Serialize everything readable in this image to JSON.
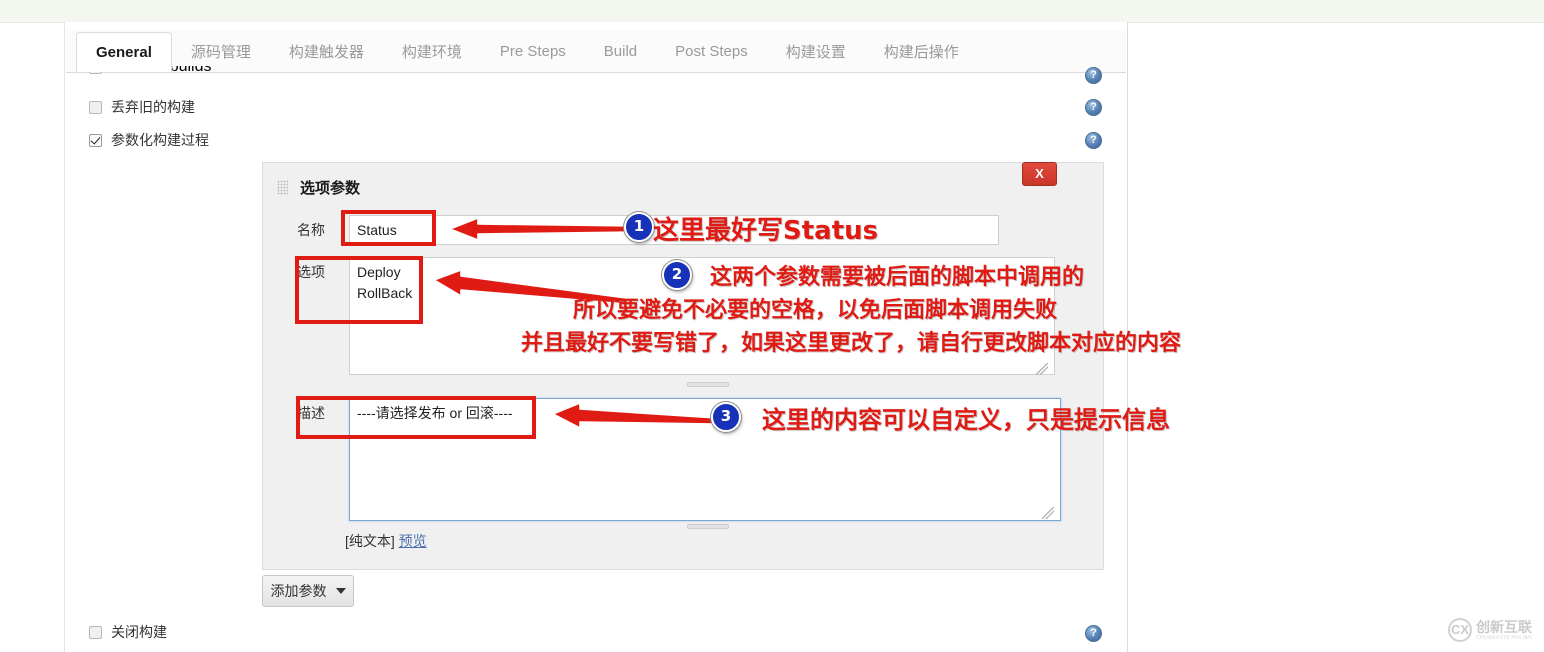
{
  "window": {
    "tabs": [
      {
        "label": "General",
        "active": true
      },
      {
        "label": "源码管理",
        "active": false
      },
      {
        "label": "构建触发器",
        "active": false
      },
      {
        "label": "构建环境",
        "active": false
      },
      {
        "label": "Pre Steps",
        "active": false
      },
      {
        "label": "Build",
        "active": false
      },
      {
        "label": "Post Steps",
        "active": false
      },
      {
        "label": "构建设置",
        "active": false
      },
      {
        "label": "构建后操作",
        "active": false
      }
    ]
  },
  "checkboxes": [
    {
      "label": "Throttle builds",
      "checked": false
    },
    {
      "label": "丢弃旧的构建",
      "checked": false
    },
    {
      "label": "参数化构建过程",
      "checked": true
    },
    {
      "label": "关闭构建",
      "checked": false
    }
  ],
  "panel": {
    "title": "选项参数",
    "close_label": "X",
    "fields": {
      "name_label": "名称",
      "name_value": "Status",
      "options_label": "选项",
      "options_value": "Deploy\nRollBack",
      "description_label": "描述",
      "description_value": "----请选择发布 or 回滚----"
    },
    "markup_prefix": "[纯文本]",
    "preview_link": "预览",
    "add_param_label": "添加参数"
  },
  "help_icon": "?",
  "annotations": [
    {
      "number": "1",
      "lines": [
        "这里最好写Status"
      ],
      "highlight": "Status"
    },
    {
      "number": "2",
      "lines": [
        "这两个参数需要被后面的脚本中调用的",
        "所以要避免不必要的空格，以免后面脚本调用失败",
        "并且最好不要写错了，如果这里更改了，请自行更改脚本对应的内容"
      ]
    },
    {
      "number": "3",
      "lines": [
        "这里的内容可以自定义，只是提示信息"
      ]
    }
  ],
  "watermark": {
    "mark": "CX",
    "cn": "创新互联",
    "en": "CHUANGXIN HULIAN"
  },
  "colors": {
    "annotation_red": "#e01b14",
    "badge_blue": "#1732b8",
    "close_red": "#c9372b",
    "link_blue": "#4a6fae"
  }
}
